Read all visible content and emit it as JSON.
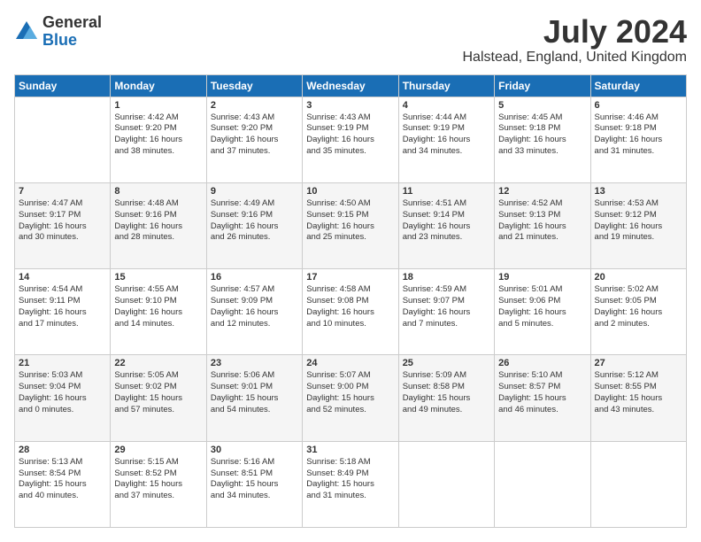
{
  "header": {
    "logo_line1": "General",
    "logo_line2": "Blue",
    "title": "July 2024",
    "subtitle": "Halstead, England, United Kingdom"
  },
  "columns": [
    "Sunday",
    "Monday",
    "Tuesday",
    "Wednesday",
    "Thursday",
    "Friday",
    "Saturday"
  ],
  "weeks": [
    [
      {
        "day": "",
        "info": ""
      },
      {
        "day": "1",
        "info": "Sunrise: 4:42 AM\nSunset: 9:20 PM\nDaylight: 16 hours\nand 38 minutes."
      },
      {
        "day": "2",
        "info": "Sunrise: 4:43 AM\nSunset: 9:20 PM\nDaylight: 16 hours\nand 37 minutes."
      },
      {
        "day": "3",
        "info": "Sunrise: 4:43 AM\nSunset: 9:19 PM\nDaylight: 16 hours\nand 35 minutes."
      },
      {
        "day": "4",
        "info": "Sunrise: 4:44 AM\nSunset: 9:19 PM\nDaylight: 16 hours\nand 34 minutes."
      },
      {
        "day": "5",
        "info": "Sunrise: 4:45 AM\nSunset: 9:18 PM\nDaylight: 16 hours\nand 33 minutes."
      },
      {
        "day": "6",
        "info": "Sunrise: 4:46 AM\nSunset: 9:18 PM\nDaylight: 16 hours\nand 31 minutes."
      }
    ],
    [
      {
        "day": "7",
        "info": "Sunrise: 4:47 AM\nSunset: 9:17 PM\nDaylight: 16 hours\nand 30 minutes."
      },
      {
        "day": "8",
        "info": "Sunrise: 4:48 AM\nSunset: 9:16 PM\nDaylight: 16 hours\nand 28 minutes."
      },
      {
        "day": "9",
        "info": "Sunrise: 4:49 AM\nSunset: 9:16 PM\nDaylight: 16 hours\nand 26 minutes."
      },
      {
        "day": "10",
        "info": "Sunrise: 4:50 AM\nSunset: 9:15 PM\nDaylight: 16 hours\nand 25 minutes."
      },
      {
        "day": "11",
        "info": "Sunrise: 4:51 AM\nSunset: 9:14 PM\nDaylight: 16 hours\nand 23 minutes."
      },
      {
        "day": "12",
        "info": "Sunrise: 4:52 AM\nSunset: 9:13 PM\nDaylight: 16 hours\nand 21 minutes."
      },
      {
        "day": "13",
        "info": "Sunrise: 4:53 AM\nSunset: 9:12 PM\nDaylight: 16 hours\nand 19 minutes."
      }
    ],
    [
      {
        "day": "14",
        "info": "Sunrise: 4:54 AM\nSunset: 9:11 PM\nDaylight: 16 hours\nand 17 minutes."
      },
      {
        "day": "15",
        "info": "Sunrise: 4:55 AM\nSunset: 9:10 PM\nDaylight: 16 hours\nand 14 minutes."
      },
      {
        "day": "16",
        "info": "Sunrise: 4:57 AM\nSunset: 9:09 PM\nDaylight: 16 hours\nand 12 minutes."
      },
      {
        "day": "17",
        "info": "Sunrise: 4:58 AM\nSunset: 9:08 PM\nDaylight: 16 hours\nand 10 minutes."
      },
      {
        "day": "18",
        "info": "Sunrise: 4:59 AM\nSunset: 9:07 PM\nDaylight: 16 hours\nand 7 minutes."
      },
      {
        "day": "19",
        "info": "Sunrise: 5:01 AM\nSunset: 9:06 PM\nDaylight: 16 hours\nand 5 minutes."
      },
      {
        "day": "20",
        "info": "Sunrise: 5:02 AM\nSunset: 9:05 PM\nDaylight: 16 hours\nand 2 minutes."
      }
    ],
    [
      {
        "day": "21",
        "info": "Sunrise: 5:03 AM\nSunset: 9:04 PM\nDaylight: 16 hours\nand 0 minutes."
      },
      {
        "day": "22",
        "info": "Sunrise: 5:05 AM\nSunset: 9:02 PM\nDaylight: 15 hours\nand 57 minutes."
      },
      {
        "day": "23",
        "info": "Sunrise: 5:06 AM\nSunset: 9:01 PM\nDaylight: 15 hours\nand 54 minutes."
      },
      {
        "day": "24",
        "info": "Sunrise: 5:07 AM\nSunset: 9:00 PM\nDaylight: 15 hours\nand 52 minutes."
      },
      {
        "day": "25",
        "info": "Sunrise: 5:09 AM\nSunset: 8:58 PM\nDaylight: 15 hours\nand 49 minutes."
      },
      {
        "day": "26",
        "info": "Sunrise: 5:10 AM\nSunset: 8:57 PM\nDaylight: 15 hours\nand 46 minutes."
      },
      {
        "day": "27",
        "info": "Sunrise: 5:12 AM\nSunset: 8:55 PM\nDaylight: 15 hours\nand 43 minutes."
      }
    ],
    [
      {
        "day": "28",
        "info": "Sunrise: 5:13 AM\nSunset: 8:54 PM\nDaylight: 15 hours\nand 40 minutes."
      },
      {
        "day": "29",
        "info": "Sunrise: 5:15 AM\nSunset: 8:52 PM\nDaylight: 15 hours\nand 37 minutes."
      },
      {
        "day": "30",
        "info": "Sunrise: 5:16 AM\nSunset: 8:51 PM\nDaylight: 15 hours\nand 34 minutes."
      },
      {
        "day": "31",
        "info": "Sunrise: 5:18 AM\nSunset: 8:49 PM\nDaylight: 15 hours\nand 31 minutes."
      },
      {
        "day": "",
        "info": ""
      },
      {
        "day": "",
        "info": ""
      },
      {
        "day": "",
        "info": ""
      }
    ]
  ]
}
